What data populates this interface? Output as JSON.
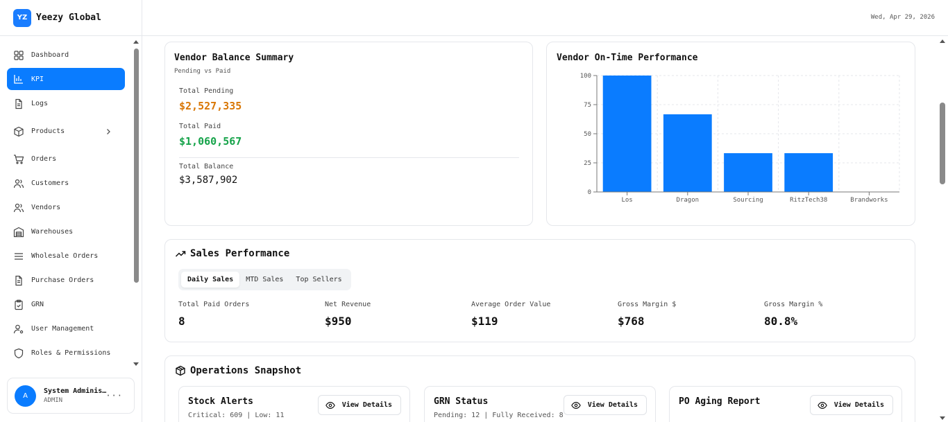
{
  "brand": {
    "logo": "YZ",
    "name": "Yeezy Global"
  },
  "header": {
    "date": "Wed, Apr 29, 2026"
  },
  "sidebar": {
    "items": [
      {
        "label": "Dashboard",
        "icon": "grid-icon"
      },
      {
        "label": "KPI",
        "icon": "bar-chart-icon",
        "active": true
      },
      {
        "label": "Logs",
        "icon": "file-icon"
      },
      {
        "label": "Products",
        "icon": "box-icon",
        "has_submenu": true
      },
      {
        "label": "Orders",
        "icon": "cart-icon"
      },
      {
        "label": "Customers",
        "icon": "users-icon"
      },
      {
        "label": "Vendors",
        "icon": "users-icon"
      },
      {
        "label": "Warehouses",
        "icon": "warehouse-icon"
      },
      {
        "label": "Wholesale Orders",
        "icon": "list-icon"
      },
      {
        "label": "Purchase Orders",
        "icon": "file-icon"
      },
      {
        "label": "GRN",
        "icon": "clipboard-icon"
      },
      {
        "label": "User Management",
        "icon": "user-cog-icon"
      },
      {
        "label": "Roles & Permissions",
        "icon": "shield-icon"
      }
    ]
  },
  "user": {
    "avatar": "A",
    "name": "System Adminis…",
    "role": "ADMIN",
    "more": "···"
  },
  "vendor_balance": {
    "title": "Vendor Balance Summary",
    "subtitle": "Pending vs Paid",
    "pending_label": "Total Pending",
    "pending_value": "$2,527,335",
    "paid_label": "Total Paid",
    "paid_value": "$1,060,567",
    "balance_label": "Total Balance",
    "balance_value": "$3,587,902",
    "colors": {
      "pending": "#d97706",
      "paid": "#16a34a"
    }
  },
  "vendor_ontime": {
    "title": "Vendor On-Time Performance"
  },
  "chart_data": {
    "type": "bar",
    "categories": [
      "Los",
      "Dragon",
      "Sourcing",
      "RitzTech38",
      "Brandworks"
    ],
    "values": [
      100,
      66.7,
      33.3,
      33.3,
      0
    ],
    "ylim": [
      0,
      100
    ],
    "yticks": [
      0,
      25,
      50,
      75,
      100
    ],
    "grid": true,
    "color": "#0a7cff"
  },
  "sales": {
    "title": "Sales Performance",
    "tabs": [
      {
        "label": "Daily Sales",
        "active": true
      },
      {
        "label": "MTD Sales"
      },
      {
        "label": "Top Sellers"
      }
    ],
    "metrics": [
      {
        "label": "Total Paid Orders",
        "value": "8"
      },
      {
        "label": "Net Revenue",
        "value": "$950"
      },
      {
        "label": "Average Order Value",
        "value": "$119"
      },
      {
        "label": "Gross Margin $",
        "value": "$768"
      },
      {
        "label": "Gross Margin %",
        "value": "80.8%"
      }
    ]
  },
  "operations": {
    "title": "Operations Snapshot",
    "cards": [
      {
        "title": "Stock Alerts",
        "subtitle": "Critical: 609 | Low: 11",
        "button": "View Details"
      },
      {
        "title": "GRN Status",
        "subtitle": "Pending: 12 | Fully Received: 8",
        "button": "View Details"
      },
      {
        "title": "PO Aging Report",
        "subtitle": "",
        "button": "View Details"
      }
    ]
  }
}
